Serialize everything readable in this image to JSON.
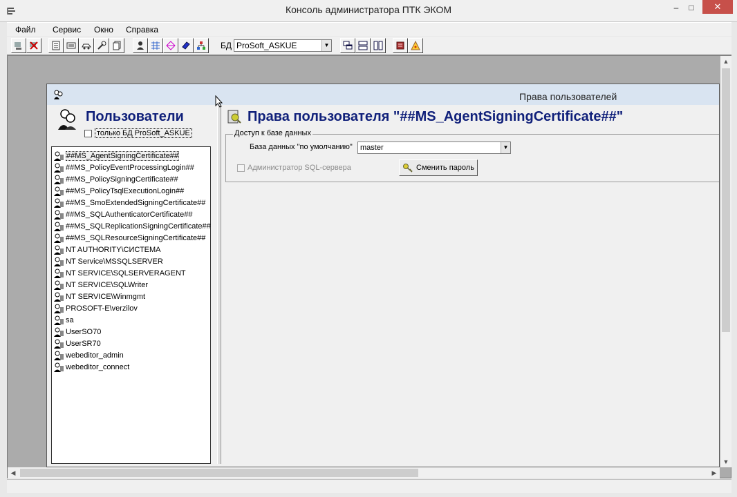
{
  "window": {
    "title": "Консоль администратора ПТК ЭКОМ",
    "min": "–",
    "max": "□",
    "close": "✕"
  },
  "menu": {
    "items": [
      "Файл",
      "Сервис",
      "Окно",
      "Справка"
    ]
  },
  "toolbar": {
    "db_label": "БД",
    "db_value": "ProSoft_ASKUE",
    "buttons": [
      "connect-icon",
      "disconnect-icon",
      "document-icon",
      "list-icon",
      "car-icon",
      "tools-icon",
      "pages-icon",
      "user-icon",
      "grid-icon",
      "arrows-icon",
      "book-icon",
      "tree-icon",
      "cascade-icon",
      "tile-horizontal-icon",
      "tile-vertical-icon",
      "help-book-icon",
      "about-icon"
    ]
  },
  "child_window": {
    "title": "Права пользователей",
    "users_heading": "Пользователи",
    "only_db_label": "только БД ProSoft_ASKUE",
    "only_db_checked": false,
    "users": [
      "##MS_AgentSigningCertificate##",
      "##MS_PolicyEventProcessingLogin##",
      "##MS_PolicySigningCertificate##",
      "##MS_PolicyTsqlExecutionLogin##",
      "##MS_SmoExtendedSigningCertificate##",
      "##MS_SQLAuthenticatorCertificate##",
      "##MS_SQLReplicationSigningCertificate##",
      "##MS_SQLResourceSigningCertificate##",
      "NT AUTHORITY\\СИСТЕМА",
      "NT Service\\MSSQLSERVER",
      "NT SERVICE\\SQLSERVERAGENT",
      "NT SERVICE\\SQLWriter",
      "NT SERVICE\\Winmgmt",
      "PROSOFT-E\\verzilov",
      "sa",
      "UserSO70",
      "UserSR70",
      "webeditor_admin",
      "webeditor_connect"
    ],
    "selected_index": 0,
    "rights_heading": "Права пользователя \"##MS_AgentSigningCertificate##\"",
    "db_access_legend": "Доступ к базе данных",
    "default_db_label": "База данных \"по умолчанию\"",
    "default_db_value": "master",
    "sql_admin_label": "Администратор SQL-сервера",
    "sql_admin_checked": false,
    "change_password_label": "Сменить пароль"
  }
}
